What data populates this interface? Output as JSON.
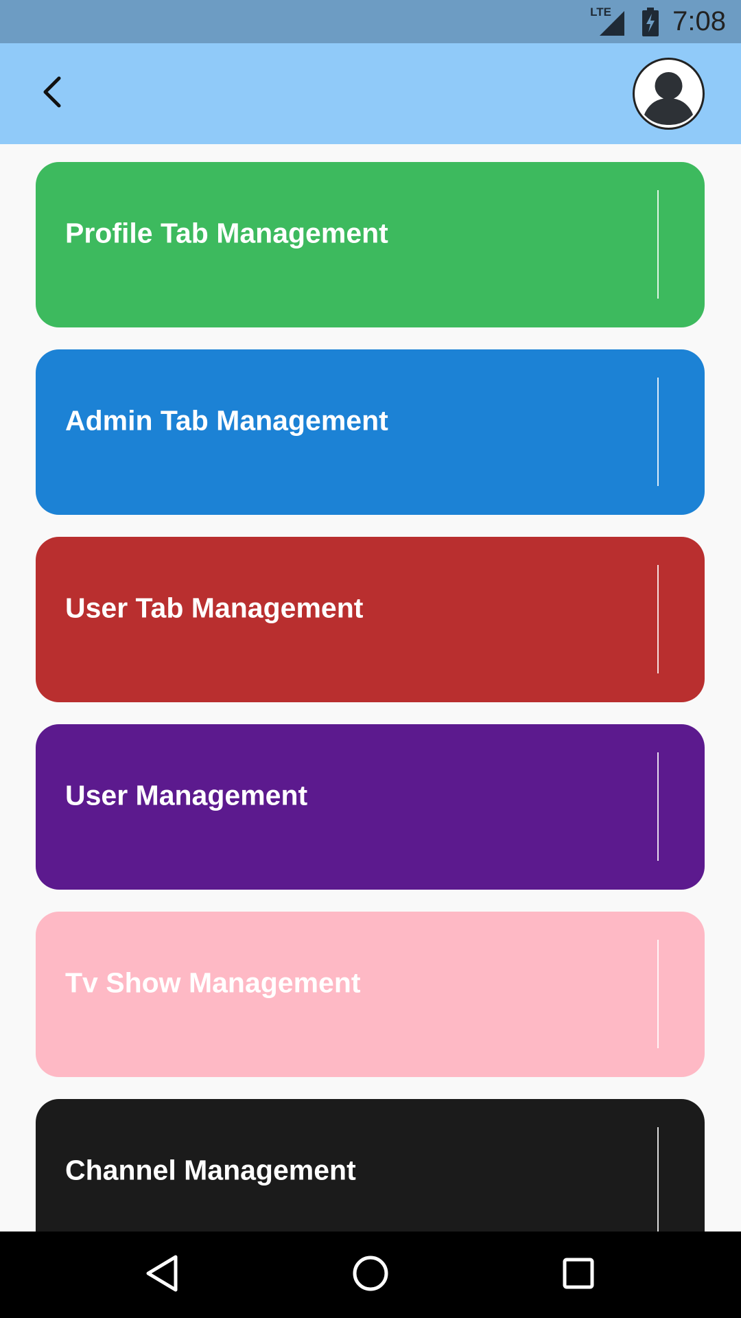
{
  "status_bar": {
    "network_label": "LTE",
    "time": "7:08",
    "icons": [
      "lte-signal-icon",
      "battery-charging-icon"
    ]
  },
  "app_bar": {
    "back_icon": "chevron-left-icon",
    "avatar_icon": "account-circle-icon"
  },
  "cards": [
    {
      "label": "Profile Tab Management",
      "color": "#3dba5e"
    },
    {
      "label": "Admin Tab Management",
      "color": "#1c82d5"
    },
    {
      "label": "User Tab Management",
      "color": "#b92f2f"
    },
    {
      "label": "User Management",
      "color": "#5c1a8e"
    },
    {
      "label": "Tv Show Management",
      "color": "#feb9c5"
    },
    {
      "label": "Channel Management",
      "color": "#1b1b1b"
    }
  ],
  "nav_bar": {
    "icons": [
      "back-triangle-icon",
      "home-circle-icon",
      "recents-square-icon"
    ]
  },
  "colors": {
    "status_bar": "#6d9cc3",
    "app_bar": "#90caf9",
    "background": "#f9f9f9"
  }
}
